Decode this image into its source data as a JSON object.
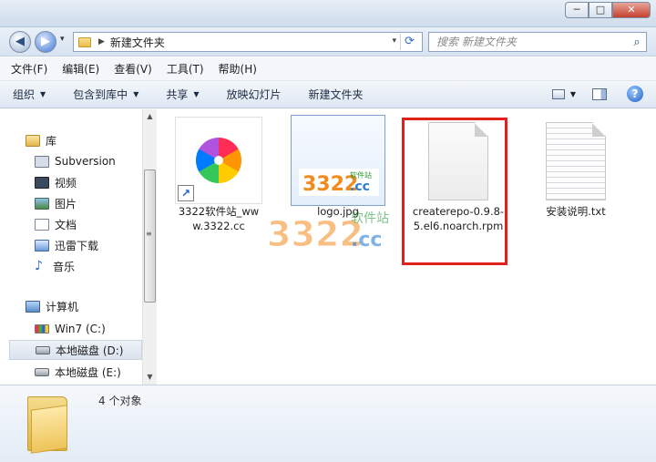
{
  "window": {
    "minimize": "─",
    "maximize": "□",
    "close": "✕"
  },
  "nav": {
    "back": "◀",
    "forward": "▶",
    "dropdown": "▾"
  },
  "address": {
    "path": "新建文件夹",
    "arrow": "▶",
    "dropdown": "▾",
    "refresh": "⟳"
  },
  "search": {
    "placeholder": "搜索 新建文件夹",
    "icon": "⌕"
  },
  "menu": [
    "文件(F)",
    "编辑(E)",
    "查看(V)",
    "工具(T)",
    "帮助(H)"
  ],
  "commands": [
    {
      "label": "组织",
      "dropdown": true
    },
    {
      "label": "包含到库中",
      "dropdown": true
    },
    {
      "label": "共享",
      "dropdown": true
    },
    {
      "label": "放映幻灯片",
      "dropdown": false
    },
    {
      "label": "新建文件夹",
      "dropdown": false
    }
  ],
  "help": "?",
  "sidebar": {
    "library": "库",
    "library_items": [
      "Subversion",
      "视频",
      "图片",
      "文档",
      "迅雷下载",
      "音乐"
    ],
    "computer": "计算机",
    "drives": [
      "Win7 (C:)",
      "本地磁盘 (D:)",
      "本地磁盘 (E:)"
    ],
    "selected_drive": 1
  },
  "files": [
    {
      "name": "3322软件站_www.3322.cc",
      "type": "shortcut"
    },
    {
      "name": "logo.jpg",
      "type": "image",
      "logo_number": "3322",
      "logo_tld": ".cc",
      "logo_cn": "软件站"
    },
    {
      "name": "createrepo-0.9.8-5.el6.noarch.rpm",
      "type": "file",
      "highlighted": true
    },
    {
      "name": "安装说明.txt",
      "type": "text"
    }
  ],
  "watermark": {
    "number": "3322",
    "tld": ".cc",
    "cn": "软件站"
  },
  "status": {
    "count": "4 个对象"
  },
  "colors": {
    "highlight": "#e2201c",
    "accent": "#1f5fc7",
    "logo_orange": "#f28a1d",
    "logo_blue": "#2d7fd6"
  }
}
